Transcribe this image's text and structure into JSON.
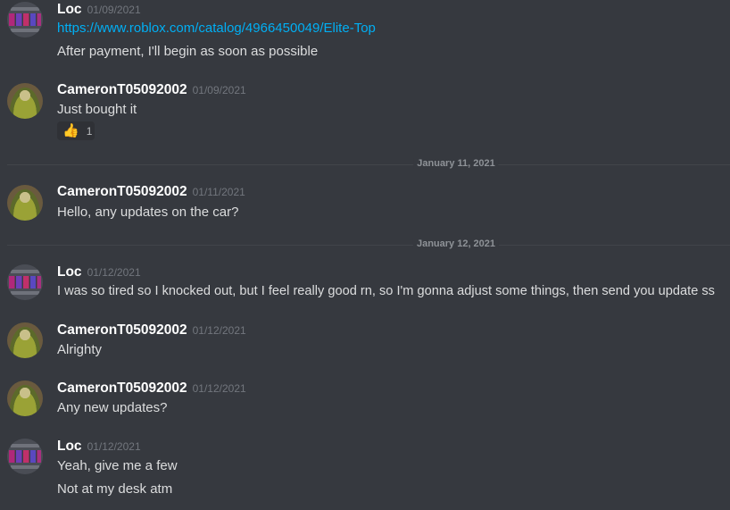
{
  "messages": [
    {
      "author": "Loc",
      "timestamp": "01/09/2021",
      "lines": [
        "https://www.roblox.com/catalog/4966450049/Elite-Top",
        "After payment, I'll begin as soon as possible"
      ]
    },
    {
      "author": "CameronT05092002",
      "timestamp": "01/09/2021",
      "lines": [
        "Just bought it"
      ],
      "reaction": {
        "emoji": "👍",
        "count": "1"
      }
    },
    {
      "author": "CameronT05092002",
      "timestamp": "01/11/2021",
      "lines": [
        "Hello, any updates on the car?"
      ]
    },
    {
      "author": "Loc",
      "timestamp": "01/12/2021",
      "lines": [
        "I was so tired so I knocked out, but I feel really good rn, so I'm gonna adjust some things, then send you update ss"
      ]
    },
    {
      "author": "CameronT05092002",
      "timestamp": "01/12/2021",
      "lines": [
        "Alrighty"
      ]
    },
    {
      "author": "CameronT05092002",
      "timestamp": "01/12/2021",
      "lines": [
        "Any new updates?"
      ]
    },
    {
      "author": "Loc",
      "timestamp": "01/12/2021",
      "lines": [
        "Yeah, give me a few",
        "Not at my desk atm"
      ]
    }
  ],
  "dividers": [
    "January 11, 2021",
    "January 12, 2021"
  ],
  "colors": {
    "background": "#36393f",
    "link": "#00aff4",
    "text": "#dcddde",
    "timestamp": "#72767d"
  }
}
